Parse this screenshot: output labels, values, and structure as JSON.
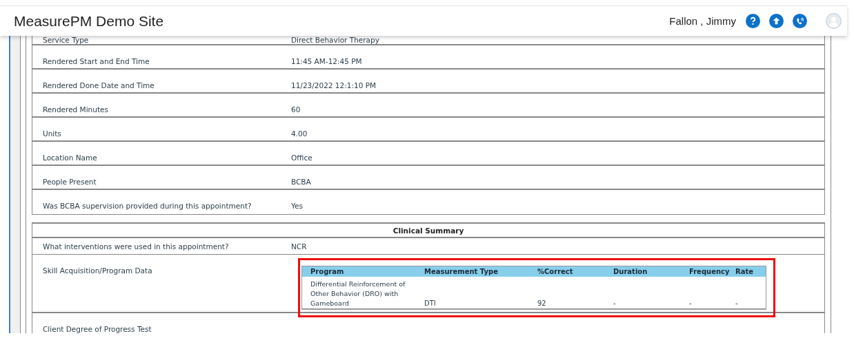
{
  "header": {
    "title": "MeasurePM Demo Site",
    "user": "Fallon , Jimmy"
  },
  "details": [
    {
      "label": "Service Type",
      "value": "Direct Behavior Therapy"
    },
    {
      "label": "Rendered Start and End Time",
      "value": "11:45 AM-12:45 PM"
    },
    {
      "label": "Rendered Done Date and Time",
      "value": "11/23/2022 12:1:10 PM"
    },
    {
      "label": "Rendered Minutes",
      "value": "60"
    },
    {
      "label": "Units",
      "value": "4.00"
    },
    {
      "label": "Location Name",
      "value": "Office"
    },
    {
      "label": "People Present",
      "value": "BCBA"
    },
    {
      "label": "Was BCBA supervision provided during this appointment?",
      "value": "Yes"
    }
  ],
  "clinical_summary": {
    "title": "Clinical Summary",
    "rows": [
      {
        "label": "What interventions were used in this appointment?",
        "value": "NCR"
      },
      {
        "label": "Skill Acquisition/Program Data",
        "program_table": {
          "highlighted": true,
          "columns": [
            "Program",
            "Measurement Type",
            "%Correct",
            "Duration",
            "Frequency",
            "Rate"
          ],
          "rows": [
            [
              "Differential Reinforcement of Other Behavior (DRO) with Gameboard",
              "DTI",
              "92",
              "-",
              "-",
              "-"
            ]
          ]
        }
      },
      {
        "label": "Client Degree of Progress Test"
      }
    ]
  }
}
